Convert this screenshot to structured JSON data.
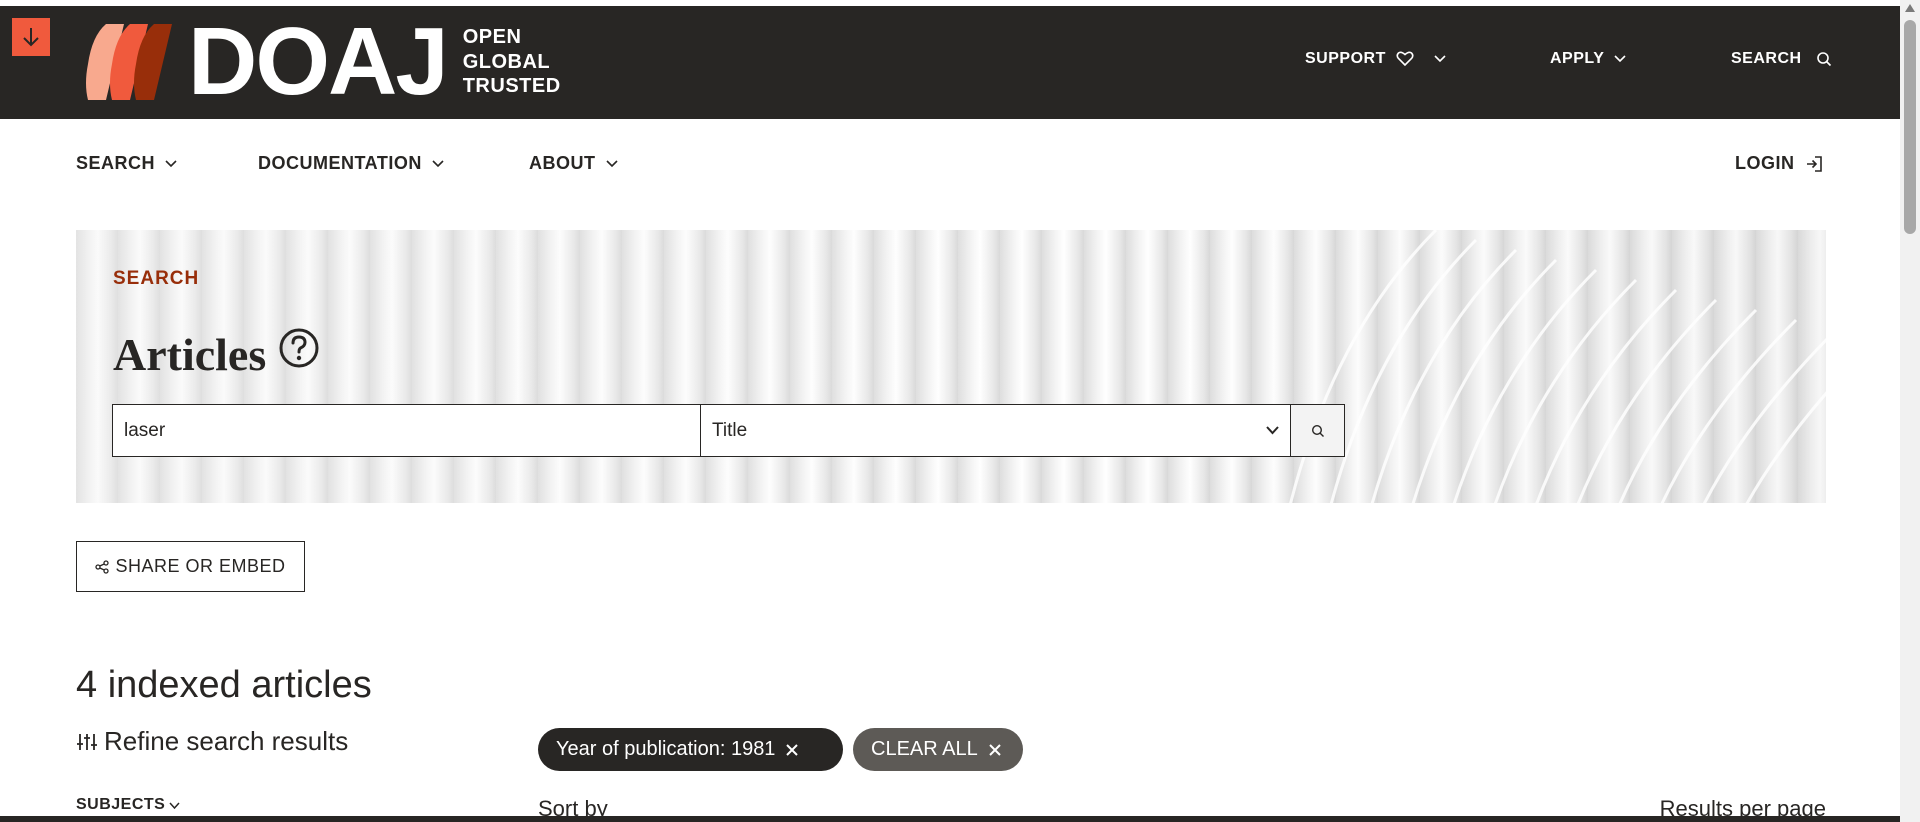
{
  "header": {
    "logo_word": "DOAJ",
    "tagline": [
      "OPEN",
      "GLOBAL",
      "TRUSTED"
    ],
    "nav": {
      "support": "SUPPORT",
      "apply": "APPLY",
      "search": "SEARCH"
    },
    "skip_icon": "arrow-down-icon"
  },
  "subnav": {
    "search": "SEARCH",
    "documentation": "DOCUMENTATION",
    "about": "ABOUT",
    "login": "LOGIN"
  },
  "hero": {
    "eyebrow": "SEARCH",
    "title": "Articles",
    "search": {
      "query": "laser",
      "field": "Title"
    }
  },
  "share_label": "SHARE OR EMBED",
  "results": {
    "count_label": "4 indexed articles",
    "refine_label": "Refine search results",
    "subjects_label": "SUBJECTS"
  },
  "filters": {
    "active": "Year of publication: 1981",
    "clear_all": "CLEAR ALL"
  },
  "sort_by": "Sort by",
  "results_per_page": "Results per page",
  "colors": {
    "dark": "#282624",
    "accent": "#f05a3d",
    "eyebrow": "#982e0a",
    "chip_secondary": "#5d5a56"
  }
}
